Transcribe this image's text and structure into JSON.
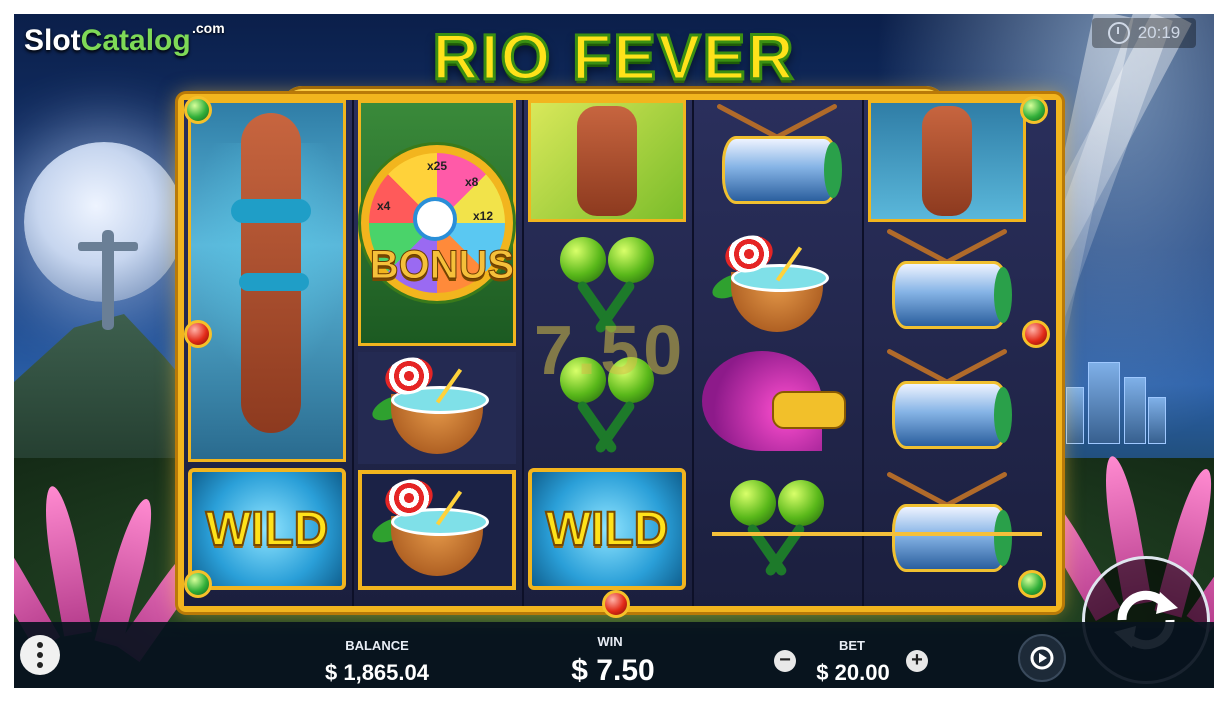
{
  "brand": {
    "slot": "Slot",
    "catalog": "Catalog",
    "com": ".com"
  },
  "game": {
    "title": "RIO FEVER"
  },
  "clock": {
    "time": "20:19",
    "icon": "clock-icon"
  },
  "reels": {
    "bonus_label": "BONUS",
    "wheel_labels": [
      "x25",
      "x8",
      "x4",
      "x12"
    ],
    "wild_label": "WILD",
    "win_overlay": "7.50"
  },
  "footer": {
    "menu_icon": "more-vertical-icon",
    "balance_label": "BALANCE",
    "balance_value": "$ 1,865.04",
    "win_label": "WIN",
    "win_value": "$ 7.50",
    "bet_label": "BET",
    "bet_value": "$ 20.00",
    "minus": "−",
    "plus": "+"
  },
  "colors": {
    "title_yellow": "#ffe21a",
    "frame_gold": "#f2b51e",
    "bar_bg": "#08121e"
  }
}
